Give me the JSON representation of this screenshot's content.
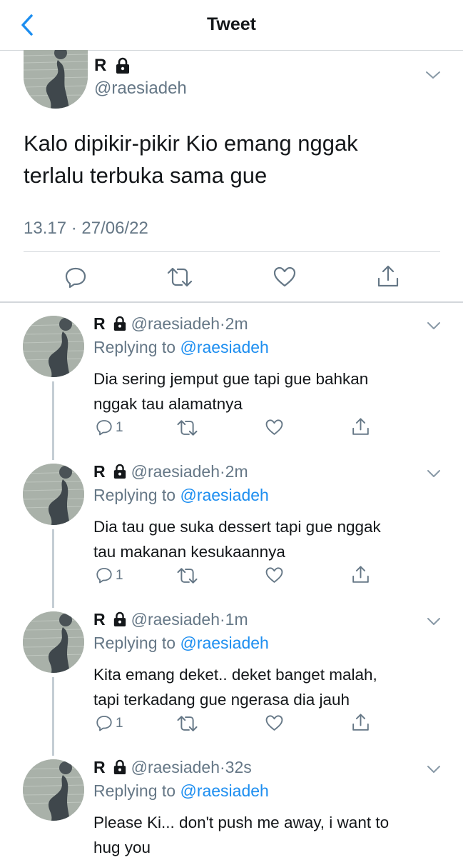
{
  "header": {
    "title": "Tweet"
  },
  "main_tweet": {
    "name": "R",
    "handle": "@raesiadeh",
    "text_line1": "Kalo dipikir-pikir Kio emang nggak",
    "text_line2": "terlalu terbuka sama gue",
    "timestamp": "13.17 · 27/06/22",
    "actions": [
      "reply-icon",
      "retweet-icon",
      "like-icon",
      "share-icon"
    ]
  },
  "replies": [
    {
      "name": "R",
      "handle": "@raesiadeh",
      "dot": "·",
      "time": "2m",
      "replying_prefix": "Replying to",
      "replying_to": "@raesiadeh",
      "line1": "Dia sering jemput gue tapi gue bahkan",
      "line2": "nggak tau alamatnya",
      "reply_count": "1"
    },
    {
      "name": "R",
      "handle": "@raesiadeh",
      "dot": "·",
      "time": "2m",
      "replying_prefix": "Replying to",
      "replying_to": "@raesiadeh",
      "line1": "Dia tau gue suka dessert tapi gue nggak",
      "line2": "tau makanan kesukaannya",
      "reply_count": "1"
    },
    {
      "name": "R",
      "handle": "@raesiadeh",
      "dot": "·",
      "time": "1m",
      "replying_prefix": "Replying to",
      "replying_to": "@raesiadeh",
      "line1": "Kita emang deket.. deket banget malah,",
      "line2": "tapi terkadang gue ngerasa dia jauh",
      "reply_count": "1"
    },
    {
      "name": "R",
      "handle": "@raesiadeh",
      "dot": "·",
      "time": "32s",
      "replying_prefix": "Replying to",
      "replying_to": "@raesiadeh",
      "line1": "Please Ki... don't push me away, i want to",
      "line2": "hug you",
      "reply_count": ""
    }
  ],
  "colors": {
    "accent": "#1d8ef0",
    "secondary_text": "#657786",
    "divider": "#d3d7db"
  }
}
